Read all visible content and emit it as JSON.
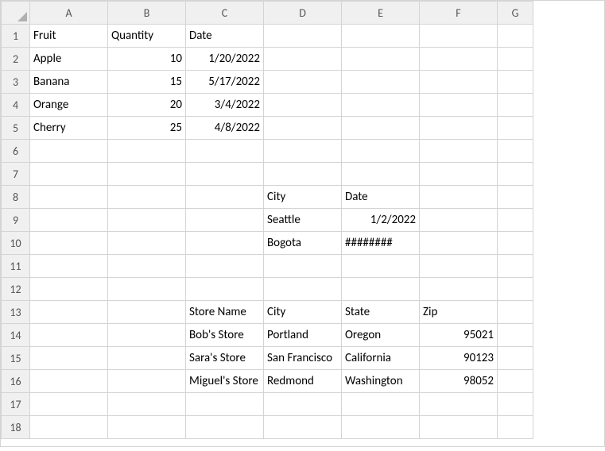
{
  "columns": [
    "A",
    "B",
    "C",
    "D",
    "E",
    "F",
    "G"
  ],
  "rows": [
    "1",
    "2",
    "3",
    "4",
    "5",
    "6",
    "7",
    "8",
    "9",
    "10",
    "11",
    "12",
    "13",
    "14",
    "15",
    "16",
    "17",
    "18"
  ],
  "cells": {
    "A1": "Fruit",
    "B1": "Quantity",
    "C1": "Date",
    "A2": "Apple",
    "B2": "10",
    "C2": "1/20/2022",
    "A3": "Banana",
    "B3": "15",
    "C3": "5/17/2022",
    "A4": "Orange",
    "B4": "20",
    "C4": "3/4/2022",
    "A5": "Cherry",
    "B5": "25",
    "C5": "4/8/2022",
    "D8": "City",
    "E8": "Date",
    "D9": "Seattle",
    "E9": "1/2/2022",
    "D10": "Bogota",
    "E10": "########",
    "C13": "Store Name",
    "D13": "City",
    "E13": "State",
    "F13": "Zip",
    "C14": "Bob's Store",
    "D14": "Portland",
    "E14": "Oregon",
    "F14": "95021",
    "C15": "Sara's Store",
    "D15": "San Francisco",
    "E15": "California",
    "F15": "90123",
    "C16": "Miguel's Store",
    "D16": "Redmond",
    "E16": "Washington",
    "F16": "98052"
  },
  "numeric_cells": [
    "B2",
    "B3",
    "B4",
    "B5",
    "C2",
    "C3",
    "C4",
    "C5",
    "E9",
    "F14",
    "F15",
    "F16"
  ],
  "chart_data": [
    {
      "type": "table",
      "title": "Fruit Quantity Date",
      "columns": [
        "Fruit",
        "Quantity",
        "Date"
      ],
      "rows": [
        [
          "Apple",
          10,
          "1/20/2022"
        ],
        [
          "Banana",
          15,
          "5/17/2022"
        ],
        [
          "Orange",
          20,
          "3/4/2022"
        ],
        [
          "Cherry",
          25,
          "4/8/2022"
        ]
      ]
    },
    {
      "type": "table",
      "title": "City Date",
      "columns": [
        "City",
        "Date"
      ],
      "rows": [
        [
          "Seattle",
          "1/2/2022"
        ],
        [
          "Bogota",
          "########"
        ]
      ]
    },
    {
      "type": "table",
      "title": "Store Name City State Zip",
      "columns": [
        "Store Name",
        "City",
        "State",
        "Zip"
      ],
      "rows": [
        [
          "Bob's Store",
          "Portland",
          "Oregon",
          95021
        ],
        [
          "Sara's Store",
          "San Francisco",
          "California",
          90123
        ],
        [
          "Miguel's Store",
          "Redmond",
          "Washington",
          98052
        ]
      ]
    }
  ]
}
